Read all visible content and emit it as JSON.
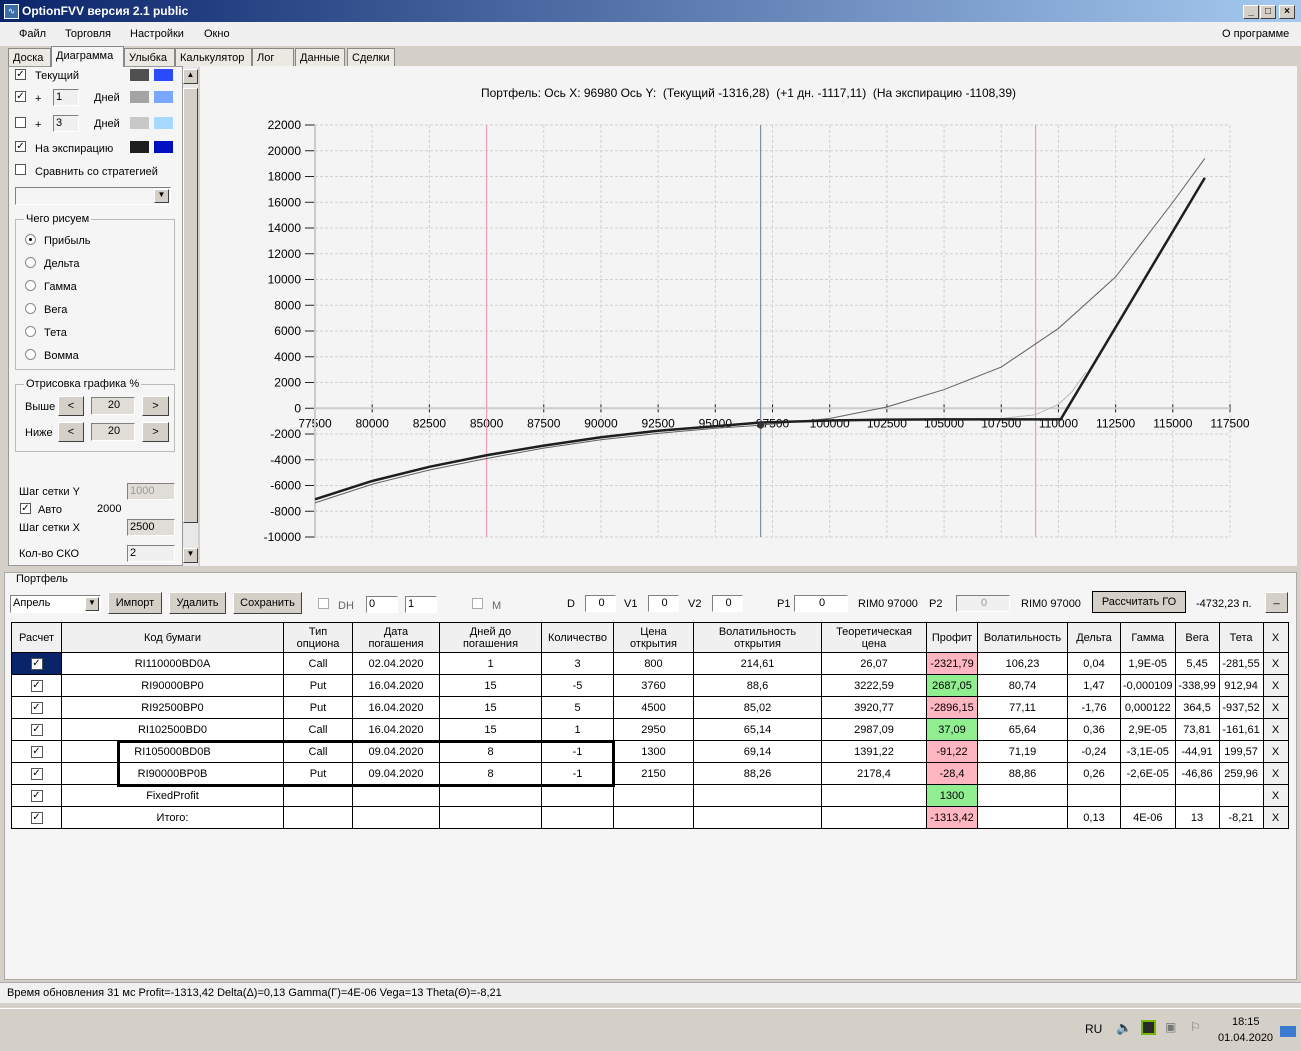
{
  "window": {
    "title": "OptionFVV версия 2.1 public",
    "minimize": "_",
    "maximize": "□",
    "close": "×"
  },
  "menu": {
    "items": [
      "Файл",
      "Торговля",
      "Настройки",
      "Окно"
    ],
    "about": "О программе"
  },
  "tabs": [
    "Доска",
    "Диаграмма",
    "Улыбка",
    "Калькулятор",
    "Лог",
    "Данные",
    "Сделки"
  ],
  "left": {
    "current_label": "Текущий",
    "plus": "+",
    "days_label": "Дней",
    "plus1_value": "1",
    "plus3_value": "3",
    "expiry_label": "На экспирацию",
    "compare_label": "Сравнить со стратегией",
    "strategy_select": "",
    "colors": {
      "current": [
        "#505050",
        "#2b4bff"
      ],
      "plus1": [
        "#a4a4a4",
        "#7aa7ff"
      ],
      "plus3": [
        "#c8c8c8",
        "#a8d8ff"
      ],
      "expiry": [
        "#1e1e1e",
        "#0010c0"
      ]
    },
    "draw_group": "Чего рисуем",
    "draw_options": [
      "Прибыль",
      "Дельта",
      "Гамма",
      "Вега",
      "Тета",
      "Вомма"
    ],
    "draw_selected": 0,
    "render_group": "Отрисовка графика %",
    "above_label": "Выше",
    "below_label": "Ниже",
    "above_value": "20",
    "below_value": "20",
    "dec": "<",
    "inc": ">",
    "grid_y_label": "Шаг сетки Y",
    "grid_y_value": "1000",
    "auto_label": "Авто",
    "auto_value": "2000",
    "grid_x_label": "Шаг сетки X",
    "grid_x_value": "2500",
    "sko_label": "Кол-во СКО",
    "sko_value": "2"
  },
  "chart_data": {
    "type": "line",
    "title": "Портфель: Ось X: 96980 Ось Y:  (Текущий -1316,28)  (+1 дн. -1117,11)  (На экспирацию -1108,39)",
    "xlim": [
      77500,
      117500
    ],
    "ylim": [
      -10000,
      22000
    ],
    "xticks": [
      77500,
      80000,
      82500,
      85000,
      87500,
      90000,
      92500,
      95000,
      97500,
      100000,
      102500,
      105000,
      107500,
      110000,
      112500,
      115000,
      117500
    ],
    "yticks": [
      22000,
      20000,
      18000,
      16000,
      14000,
      12000,
      10000,
      8000,
      6000,
      4000,
      2000,
      0,
      -2000,
      -4000,
      -6000,
      -8000,
      -10000
    ],
    "grid": true,
    "vlines": [
      {
        "x": 85000,
        "color": "#f0a0b0"
      },
      {
        "x": 109000,
        "color": "#f0a0b0"
      },
      {
        "x": 96980,
        "color": "#8090a0"
      }
    ],
    "marker": {
      "x": 96980,
      "y": -1316
    },
    "series": [
      {
        "name": "Текущий",
        "color": "#606060",
        "width": 1,
        "points": [
          [
            77500,
            -7350
          ],
          [
            80000,
            -5900
          ],
          [
            82500,
            -4800
          ],
          [
            85000,
            -3900
          ],
          [
            87500,
            -3100
          ],
          [
            90000,
            -2450
          ],
          [
            92500,
            -1950
          ],
          [
            95000,
            -1550
          ],
          [
            96980,
            -1316
          ],
          [
            100000,
            -800
          ],
          [
            102500,
            100
          ],
          [
            105000,
            1450
          ],
          [
            107500,
            3200
          ],
          [
            110000,
            6200
          ],
          [
            112500,
            10200
          ],
          [
            115000,
            16000
          ],
          [
            116400,
            19400
          ]
        ]
      },
      {
        "name": "+1 дн.",
        "color": "#b8b8b8",
        "width": 1,
        "points": [
          [
            105000,
            -860
          ],
          [
            107500,
            -800
          ],
          [
            109000,
            -500
          ],
          [
            110000,
            300
          ],
          [
            110600,
            1300
          ],
          [
            111200,
            2800
          ]
        ]
      },
      {
        "name": "На экспирацию",
        "color": "#1e1e1e",
        "width": 2.5,
        "points": [
          [
            77500,
            -7070
          ],
          [
            80000,
            -5650
          ],
          [
            82500,
            -4550
          ],
          [
            85000,
            -3650
          ],
          [
            87500,
            -2900
          ],
          [
            90000,
            -2250
          ],
          [
            92500,
            -1750
          ],
          [
            95000,
            -1400
          ],
          [
            97000,
            -1108
          ],
          [
            100000,
            -950
          ],
          [
            102500,
            -880
          ],
          [
            105000,
            -860
          ],
          [
            107500,
            -860
          ],
          [
            110100,
            -860
          ],
          [
            116400,
            17900
          ]
        ]
      }
    ]
  },
  "portfolio": {
    "group": "Портфель",
    "month": "Апрель",
    "import": "Импорт",
    "delete": "Удалить",
    "save": "Сохранить",
    "dh_label": "DH",
    "spin1": "0",
    "spin2": "1",
    "m_label": "M",
    "d_label": "D",
    "d_value": "0",
    "v1_label": "V1",
    "v1_value": "0",
    "v2_label": "V2",
    "v2_value": "0",
    "p1_label": "P1",
    "p1_value": "0",
    "p1_instr": "RIM0 97000",
    "p2_label": "P2",
    "p2_value": "0",
    "p2_instr": "RIM0 97000",
    "calc_go": "Рассчитать ГО",
    "go_value": "-4732,23 п.",
    "collapse": "_"
  },
  "table": {
    "headers": [
      "Расчет",
      "Код бумаги",
      "Тип\nопциона",
      "Дата\nпогашения",
      "Дней до\nпогашения",
      "Количество",
      "Цена\nоткрытия",
      "Волатильность\nоткрытия",
      "Теоретическая\nцена",
      "Профит",
      "Волатильность",
      "Дельта",
      "Гамма",
      "Вега",
      "Тета",
      "X"
    ],
    "rows": [
      [
        "RI110000BD0A",
        "Call",
        "02.04.2020",
        "1",
        "3",
        "800",
        "214,61",
        "26,07",
        "-2321,79",
        "106,23",
        "0,04",
        "1,9E-05",
        "5,45",
        "-281,55"
      ],
      [
        "RI90000BP0",
        "Put",
        "16.04.2020",
        "15",
        "-5",
        "3760",
        "88,6",
        "3222,59",
        "2687,05",
        "80,74",
        "1,47",
        "-0,000109",
        "-338,99",
        "912,94"
      ],
      [
        "RI92500BP0",
        "Put",
        "16.04.2020",
        "15",
        "5",
        "4500",
        "85,02",
        "3920,77",
        "-2896,15",
        "77,11",
        "-1,76",
        "0,000122",
        "364,5",
        "-937,52"
      ],
      [
        "RI102500BD0",
        "Call",
        "16.04.2020",
        "15",
        "1",
        "2950",
        "65,14",
        "2987,09",
        "37,09",
        "65,64",
        "0,36",
        "2,9E-05",
        "73,81",
        "-161,61"
      ],
      [
        "RI105000BD0B",
        "Call",
        "09.04.2020",
        "8",
        "-1",
        "1300",
        "69,14",
        "1391,22",
        "-91,22",
        "71,19",
        "-0,24",
        "-3,1E-05",
        "-44,91",
        "199,57"
      ],
      [
        "RI90000BP0B",
        "Put",
        "09.04.2020",
        "8",
        "-1",
        "2150",
        "88,26",
        "2178,4",
        "-28,4",
        "88,86",
        "0,26",
        "-2,6E-05",
        "-46,86",
        "259,96"
      ],
      [
        "FixedProfit",
        "",
        "",
        "",
        "",
        "",
        "",
        "",
        "1300",
        "",
        "",
        "",
        "",
        ""
      ],
      [
        "Итого:",
        "",
        "",
        "",
        "",
        "",
        "",
        "",
        "-1313,42",
        "",
        "0,13",
        "4E-06",
        "13",
        "-8,21"
      ]
    ],
    "check": "✓",
    "remove": "X"
  },
  "status": "Время обновления 31 мс  Profit=-1313,42 Delta(Δ)=0,13 Gamma(Γ)=4E-06 Vega=13 Theta(Θ)=-8,21",
  "taskbar": {
    "lang": "RU",
    "time": "18:15",
    "date": "01.04.2020"
  }
}
